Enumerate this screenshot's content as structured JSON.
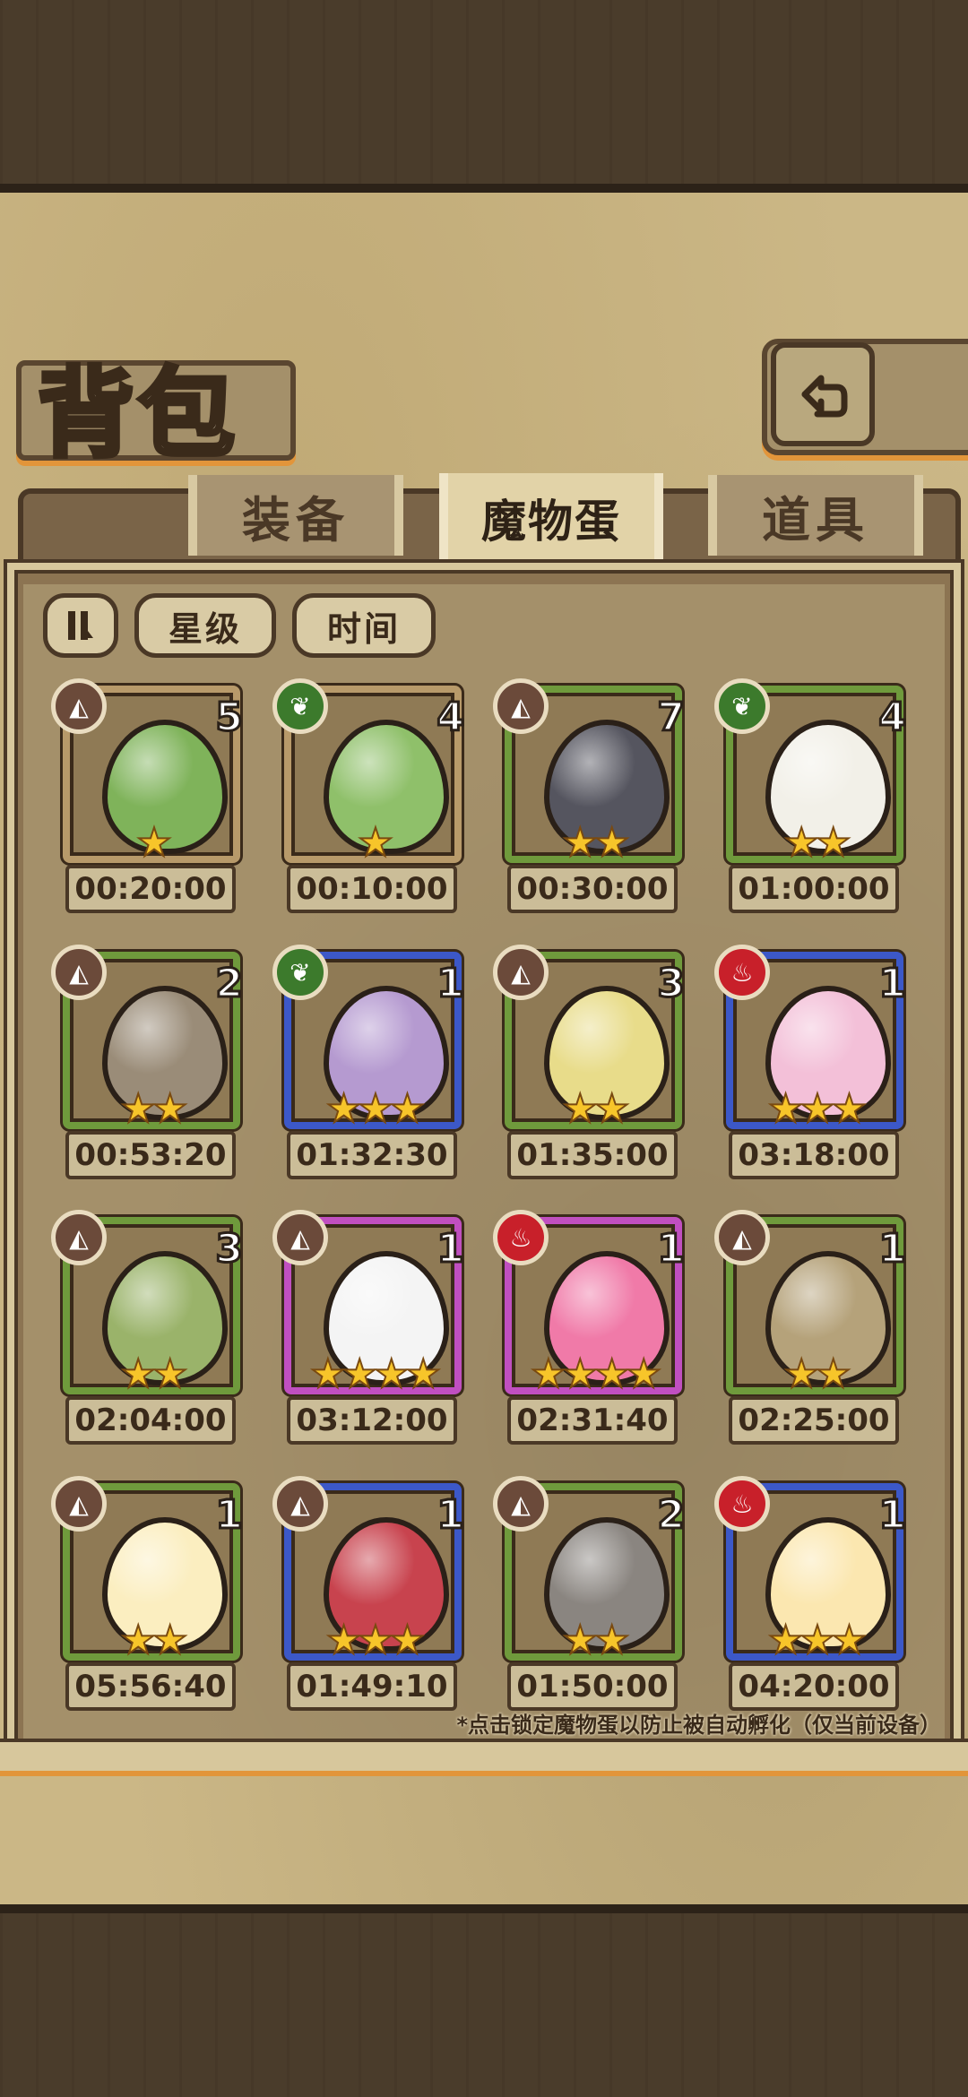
{
  "title": "背包",
  "tabs": [
    {
      "label": "装备",
      "active": false
    },
    {
      "label": "魔物蛋",
      "active": true
    },
    {
      "label": "道具",
      "active": false
    }
  ],
  "sort": {
    "toggle_icon": "pause-sort-icon",
    "star_label": "星级",
    "time_label": "时间"
  },
  "eggs": [
    {
      "element": "earth",
      "count": "5",
      "stars": "★",
      "time": "00:20:00",
      "rarity": "tan",
      "egg_color": "#7fb35a"
    },
    {
      "element": "grass",
      "count": "4",
      "stars": "★",
      "time": "00:10:00",
      "rarity": "tan",
      "egg_color": "#8fc06a"
    },
    {
      "element": "earth",
      "count": "7",
      "stars": "★★",
      "time": "00:30:00",
      "rarity": "green",
      "egg_color": "#55555f"
    },
    {
      "element": "grass",
      "count": "4",
      "stars": "★★",
      "time": "01:00:00",
      "rarity": "green",
      "egg_color": "#f2f0e8"
    },
    {
      "element": "earth",
      "count": "2",
      "stars": "★★",
      "time": "00:53:20",
      "rarity": "green",
      "egg_color": "#9a8c78"
    },
    {
      "element": "grass",
      "count": "1",
      "stars": "★★★",
      "time": "01:32:30",
      "rarity": "blue",
      "egg_color": "#b59ad0"
    },
    {
      "element": "earth",
      "count": "3",
      "stars": "★★",
      "time": "01:35:00",
      "rarity": "green",
      "egg_color": "#e8dc8a"
    },
    {
      "element": "fire",
      "count": "1",
      "stars": "★★★",
      "time": "03:18:00",
      "rarity": "blue",
      "egg_color": "#f3c0d8"
    },
    {
      "element": "earth",
      "count": "3",
      "stars": "★★",
      "time": "02:04:00",
      "rarity": "green",
      "egg_color": "#9ab36a"
    },
    {
      "element": "earth",
      "count": "1",
      "stars": "★★★★",
      "time": "03:12:00",
      "rarity": "purple",
      "egg_color": "#f4f4f4"
    },
    {
      "element": "fire",
      "count": "1",
      "stars": "★★★★",
      "time": "02:31:40",
      "rarity": "purple",
      "egg_color": "#f07aa8"
    },
    {
      "element": "earth",
      "count": "1",
      "stars": "★★",
      "time": "02:25:00",
      "rarity": "green",
      "egg_color": "#b5a27a"
    },
    {
      "element": "earth",
      "count": "1",
      "stars": "★★",
      "time": "05:56:40",
      "rarity": "green",
      "egg_color": "#fbeec0"
    },
    {
      "element": "earth",
      "count": "1",
      "stars": "★★★",
      "time": "01:49:10",
      "rarity": "blue",
      "egg_color": "#c8434e"
    },
    {
      "element": "earth",
      "count": "2",
      "stars": "★★",
      "time": "01:50:00",
      "rarity": "green",
      "egg_color": "#8a8580"
    },
    {
      "element": "fire",
      "count": "1",
      "stars": "★★★",
      "time": "04:20:00",
      "rarity": "blue",
      "egg_color": "#fbe7b0"
    }
  ],
  "hint": "*点击锁定魔物蛋以防止被自动孵化（仅当前设备）",
  "colors": {
    "earth": "#6b4a3a",
    "grass": "#3c7a2c",
    "fire": "#c8202a"
  }
}
